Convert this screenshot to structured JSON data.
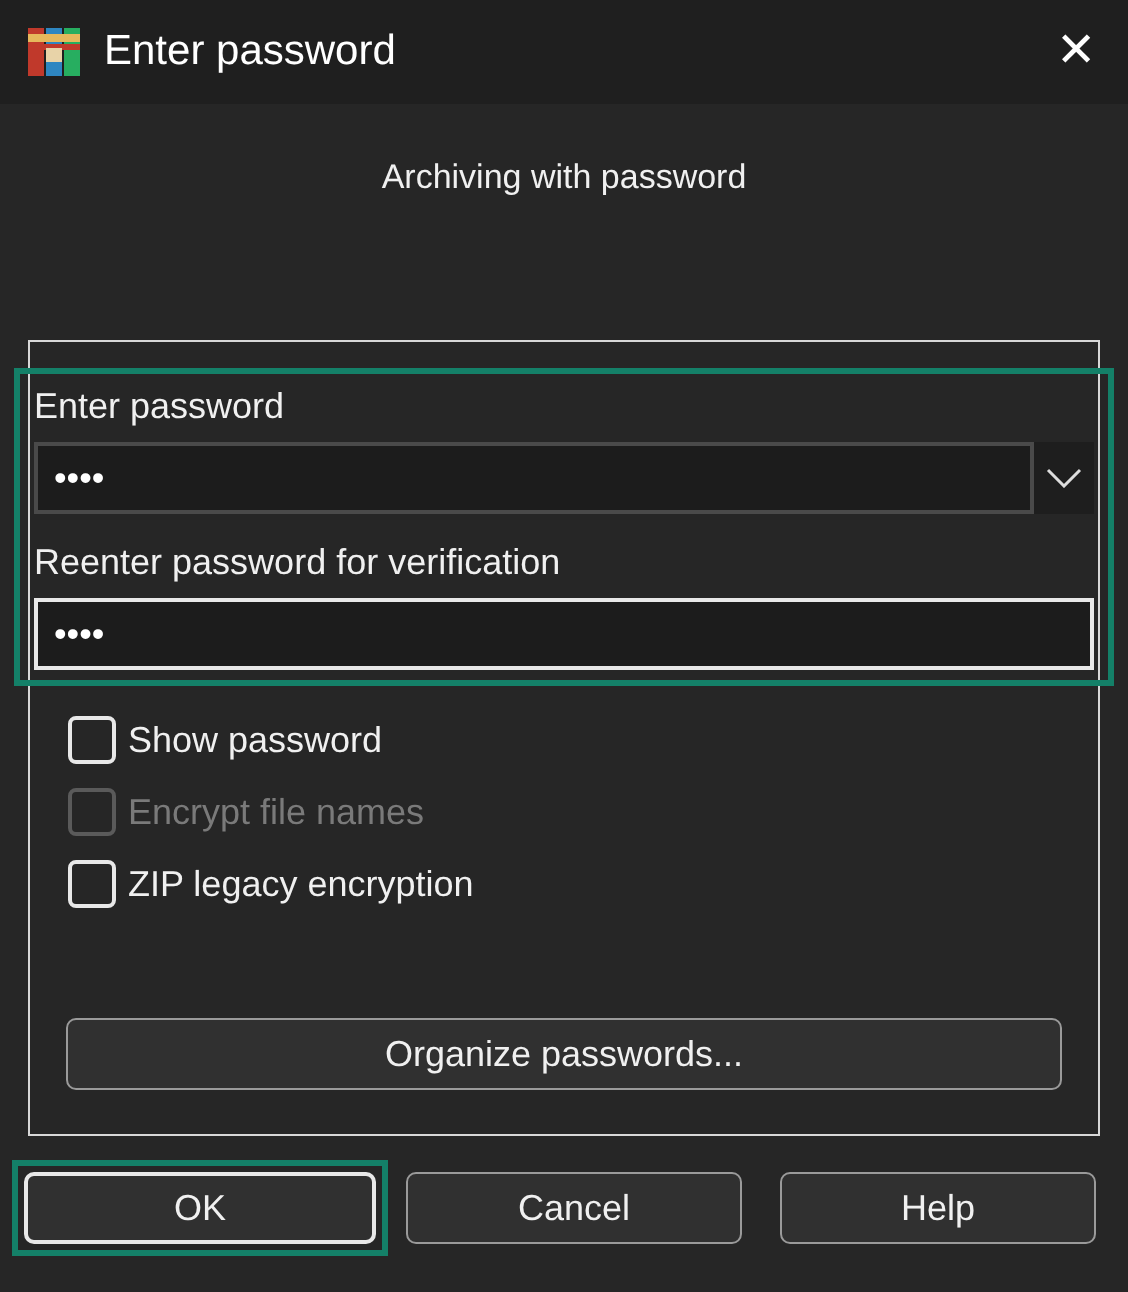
{
  "window": {
    "title": "Enter password",
    "close": "✕"
  },
  "subtitle": "Archiving with password",
  "password_fields": {
    "highlighted": true,
    "fields": [
      {
        "kind": "combo",
        "label": "Enter password",
        "value": "••••",
        "focused": false
      },
      {
        "kind": "text",
        "label": "Reenter password for verification",
        "value": "••••",
        "focused": true
      }
    ]
  },
  "options": [
    {
      "label": "Show password",
      "checked": false,
      "disabled": false
    },
    {
      "label": "Encrypt file names",
      "checked": false,
      "disabled": true
    },
    {
      "label": "ZIP legacy encryption",
      "checked": false,
      "disabled": false
    }
  ],
  "organize_button": "Organize passwords...",
  "buttons": [
    {
      "label": "OK",
      "highlighted": true,
      "default": true
    },
    {
      "label": "Cancel",
      "highlighted": false,
      "default": false
    },
    {
      "label": "Help",
      "highlighted": false,
      "default": false
    }
  ]
}
